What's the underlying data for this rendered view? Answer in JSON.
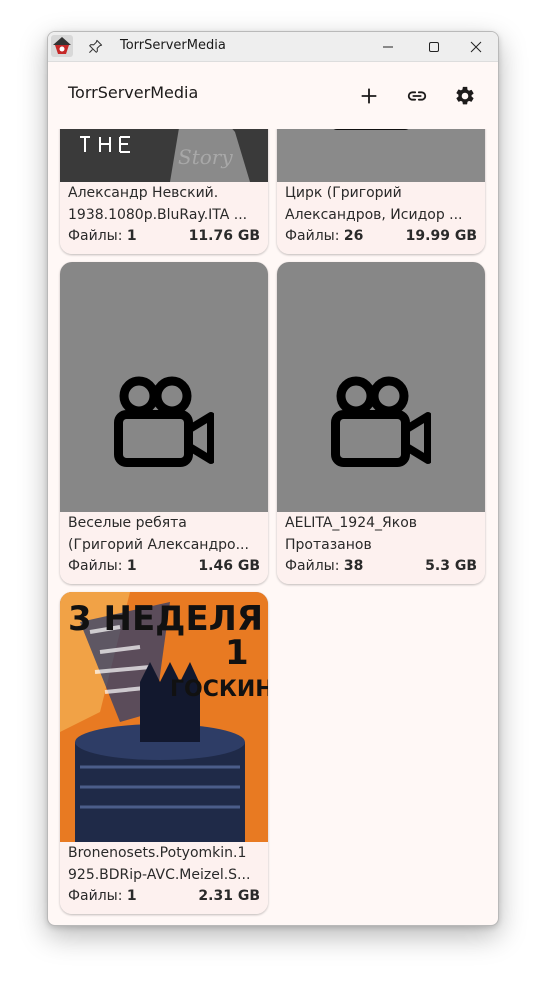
{
  "window": {
    "title": "TorrServerMedia"
  },
  "appbar": {
    "title": "TorrServerMedia",
    "icons": [
      "add-icon",
      "link-icon",
      "settings-icon"
    ]
  },
  "files_label": "Файлы:",
  "cards": [
    {
      "line1": "Александр Невский.",
      "line2": "1938.1080p.BluRay.ITA ...",
      "files": "1",
      "size": "11.76 GB",
      "poster": "photo"
    },
    {
      "line1": "Цирк (Григорий",
      "line2": "Александров, Исидор ...",
      "files": "26",
      "size": "19.99 GB",
      "poster": "photo"
    },
    {
      "line1": "Веселые ребята",
      "line2": "(Григорий Александро...",
      "files": "1",
      "size": "1.46 GB",
      "poster": "video-camera-icon"
    },
    {
      "line1": "AELITA_1924_Яков",
      "line2": "Протазанов",
      "files": "38",
      "size": "5.3 GB",
      "poster": "video-camera-icon"
    },
    {
      "line1": "Bronenosets.Potyomkin.1",
      "line2": "925.BDRip-AVC.Meizel.S...",
      "files": "1",
      "size": "2.31 GB",
      "poster": "photo",
      "poster_text": {
        "top": "3 НЕДЕЛЯ",
        "mid": "1",
        "bottom": "ГОСКИНО"
      }
    }
  ],
  "colors": {
    "background": "#fff8f6",
    "card": "#fdf1ef",
    "placeholder": "#878787",
    "poster_orange": "#e87a22"
  }
}
